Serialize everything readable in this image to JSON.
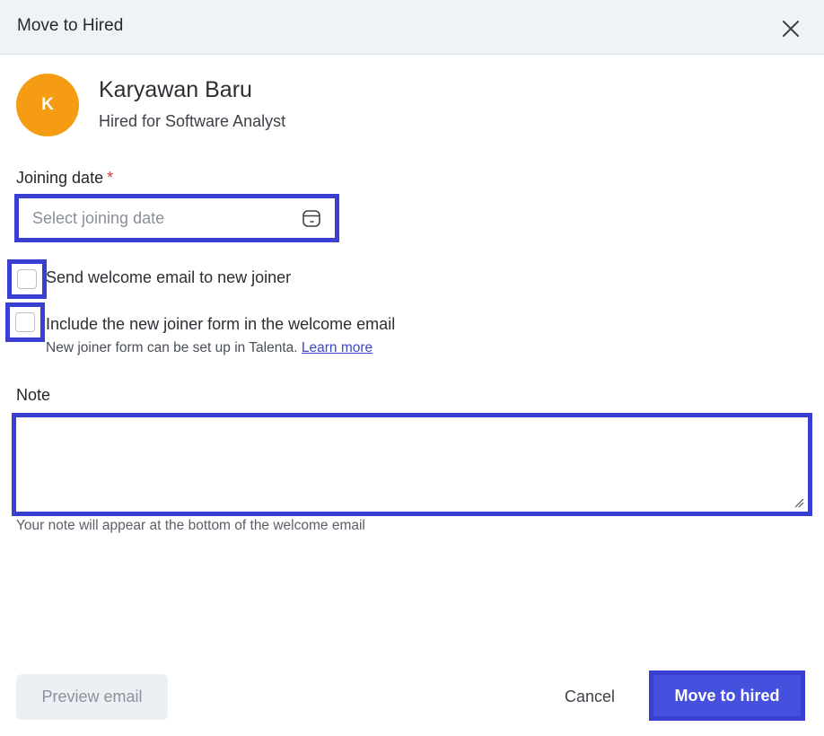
{
  "dialog": {
    "title": "Move to Hired",
    "close_icon": "close-icon"
  },
  "candidate": {
    "initial": "K",
    "name": "Karyawan Baru",
    "role": "Hired for Software Analyst",
    "avatar_color": "#f59c12"
  },
  "joining_date": {
    "label": "Joining date",
    "required_marker": "*",
    "placeholder": "Select joining date",
    "value": "",
    "icon": "calendar-icon"
  },
  "options": {
    "send_welcome": {
      "label": "Send welcome email to new joiner",
      "checked": false
    },
    "include_form": {
      "label": "Include the new joiner form in the welcome email",
      "checked": false,
      "help_text": "New joiner form can be set up in Talenta.",
      "link_text": "Learn more"
    }
  },
  "note": {
    "label": "Note",
    "value": "",
    "help_text": "Your note will appear at the bottom of the welcome email"
  },
  "footer": {
    "preview_label": "Preview email",
    "cancel_label": "Cancel",
    "submit_label": "Move to hired"
  },
  "colors": {
    "accent": "#4550de",
    "highlight": "#3b3fd1",
    "required": "#d4362f",
    "header_bg": "#eff2f6"
  }
}
